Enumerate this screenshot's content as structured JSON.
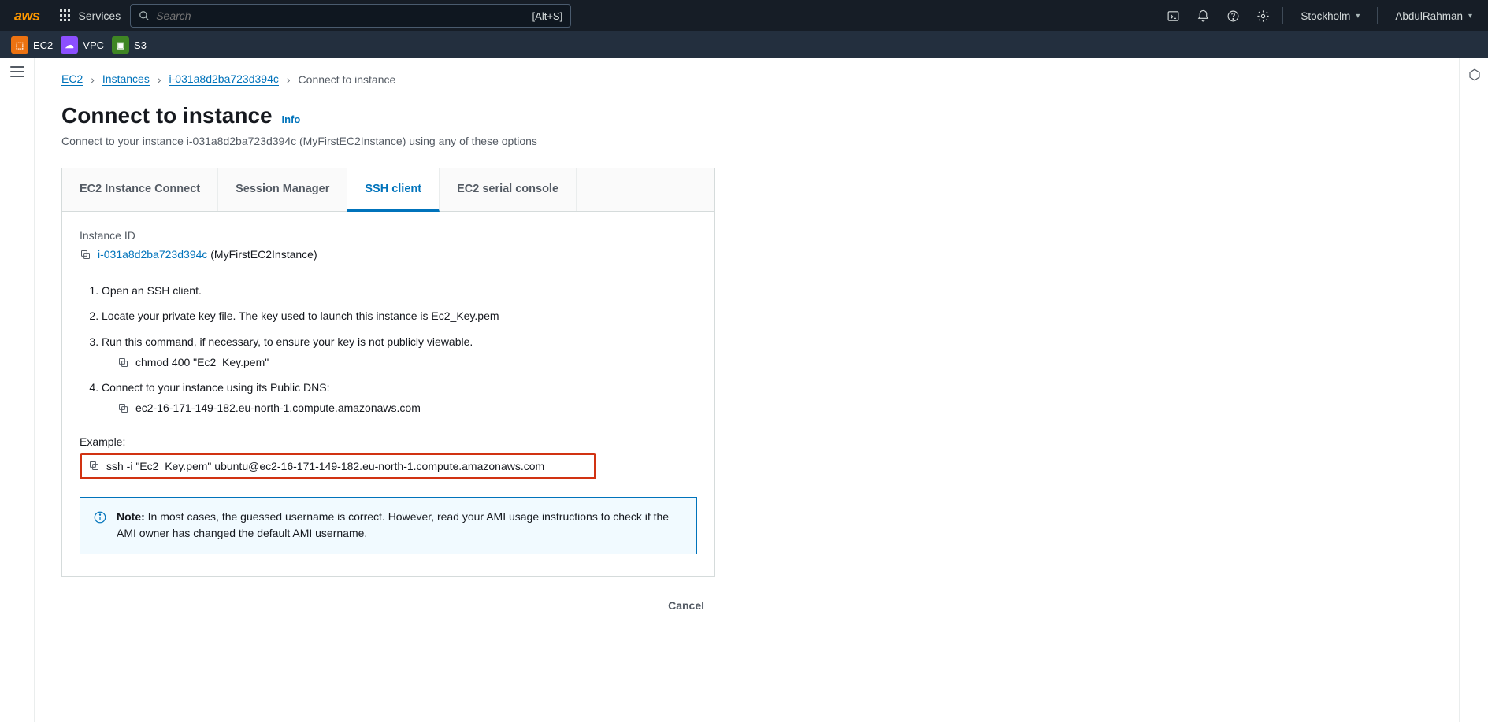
{
  "topnav": {
    "logo": "aws",
    "services": "Services",
    "search_placeholder": "Search",
    "shortcut": "[Alt+S]",
    "region": "Stockholm",
    "user": "AbdulRahman"
  },
  "pinned": [
    {
      "label": "EC2"
    },
    {
      "label": "VPC"
    },
    {
      "label": "S3"
    }
  ],
  "breadcrumbs": {
    "ec2": "EC2",
    "instances": "Instances",
    "instance_id": "i-031a8d2ba723d394c",
    "current": "Connect to instance"
  },
  "page": {
    "title": "Connect to instance",
    "info": "Info",
    "subtitle": "Connect to your instance i-031a8d2ba723d394c (MyFirstEC2Instance) using any of these options"
  },
  "tabs": {
    "ec2_connect": "EC2 Instance Connect",
    "session_manager": "Session Manager",
    "ssh_client": "SSH client",
    "serial": "EC2 serial console"
  },
  "ssh": {
    "instance_id_label": "Instance ID",
    "instance_id": "i-031a8d2ba723d394c",
    "instance_name_paren": " (MyFirstEC2Instance)",
    "step1": "Open an SSH client.",
    "step2": "Locate your private key file. The key used to launch this instance is Ec2_Key.pem",
    "step3": "Run this command, if necessary, to ensure your key is not publicly viewable.",
    "step3_cmd": "chmod 400 \"Ec2_Key.pem\"",
    "step4": "Connect to your instance using its Public DNS:",
    "step4_dns": "ec2-16-171-149-182.eu-north-1.compute.amazonaws.com",
    "example_label": "Example:",
    "example_cmd": "ssh -i \"Ec2_Key.pem\" ubuntu@ec2-16-171-149-182.eu-north-1.compute.amazonaws.com",
    "note_label": "Note:",
    "note_body": " In most cases, the guessed username is correct. However, read your AMI usage instructions to check if the AMI owner has changed the default AMI username."
  },
  "actions": {
    "cancel": "Cancel"
  }
}
